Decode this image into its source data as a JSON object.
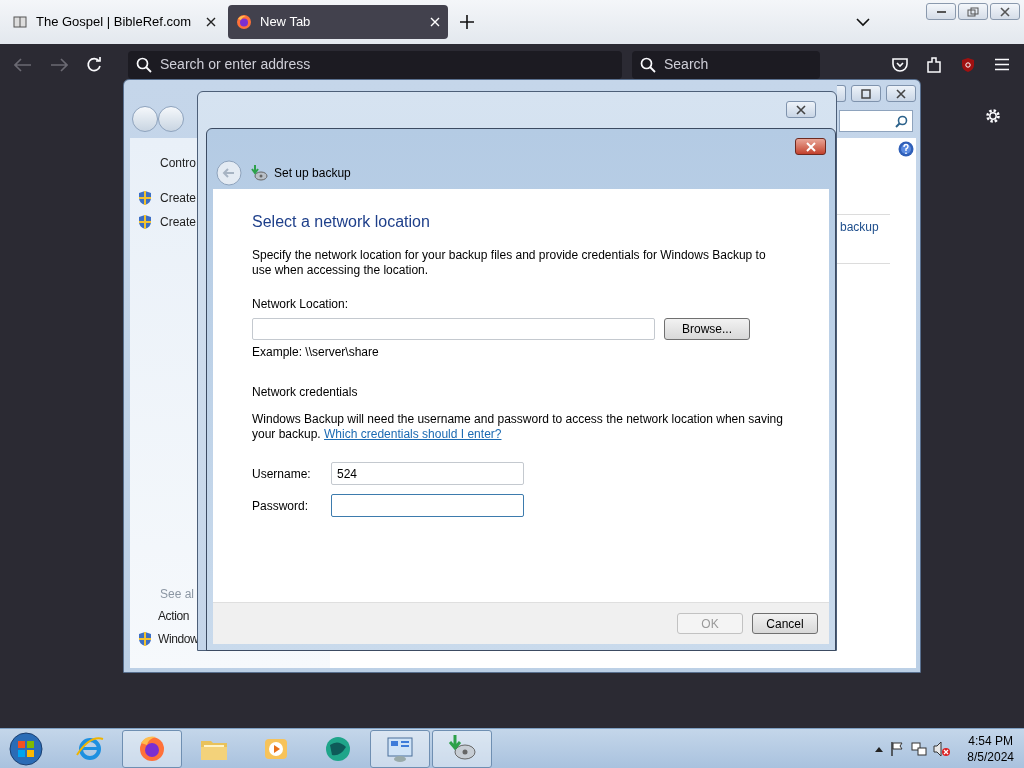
{
  "browser": {
    "tabs": [
      {
        "title": "The Gospel | BibleRef.com",
        "selected": false
      },
      {
        "title": "New Tab",
        "selected": true
      }
    ],
    "address": {
      "placeholder": "Search or enter address"
    },
    "search": {
      "placeholder": "Search"
    }
  },
  "control_panel": {
    "breadcrumb": "Contro",
    "sidebar": [
      {
        "kind": "shield",
        "text": "Create"
      },
      {
        "kind": "shield",
        "text": "Create"
      }
    ],
    "see_also": {
      "heading": "See al",
      "items": [
        {
          "kind": "plain",
          "text": "Action"
        },
        {
          "kind": "shield",
          "text": "Window"
        }
      ]
    },
    "link": "backup"
  },
  "dialog": {
    "title": "Set up backup",
    "heading": "Select a network location",
    "description": "Specify the network location for your backup files and provide credentials for Windows Backup to use when accessing the location.",
    "location": {
      "label": "Network Location:",
      "browse": "Browse...",
      "example": "Example: \\\\server\\share"
    },
    "credentials": {
      "heading": "Network credentials",
      "text": "Windows Backup will need the username and password to access the network location when saving your backup.",
      "link": "Which credentials should I enter?"
    },
    "fields": [
      {
        "label": "Username:",
        "value": "524",
        "focused": false
      },
      {
        "label": "Password:",
        "focused": true
      }
    ],
    "buttons": [
      {
        "label": "OK",
        "disabled": true
      },
      {
        "label": "Cancel",
        "disabled": false
      }
    ]
  },
  "taskbar": {
    "items": [
      {
        "kind": "ie",
        "running": false
      },
      {
        "kind": "firefox",
        "running": true
      },
      {
        "kind": "folder",
        "running": false
      },
      {
        "kind": "media",
        "running": false
      },
      {
        "kind": "globe",
        "running": false
      },
      {
        "kind": "control",
        "running": true
      },
      {
        "kind": "backup",
        "running": true
      }
    ],
    "time": "4:54 PM",
    "date": "8/5/2024"
  }
}
